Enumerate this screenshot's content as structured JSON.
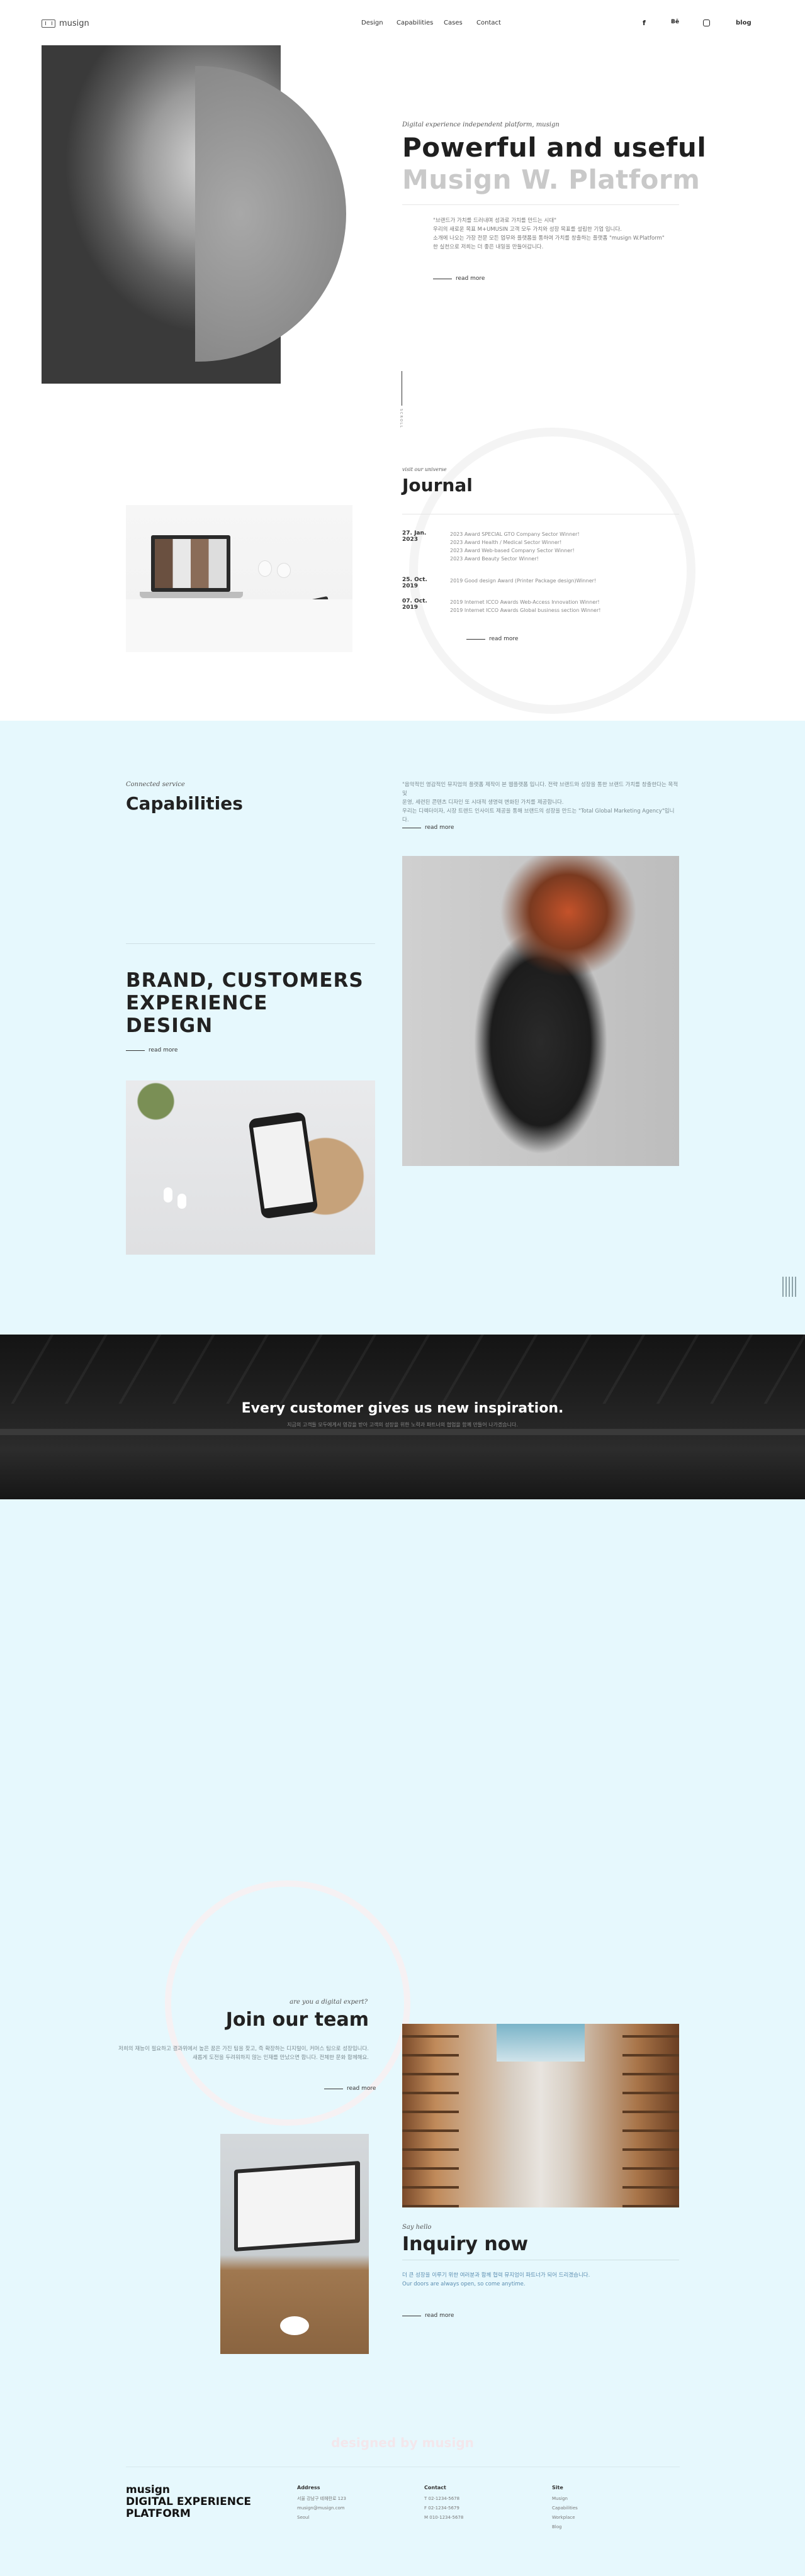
{
  "header": {
    "logo_text": "musign",
    "nav": [
      "Design",
      "Capabilities",
      "Cases",
      "Contact"
    ],
    "social_icons": [
      "facebook-icon",
      "behance-icon",
      "instagram-icon"
    ],
    "blog_label": "blog"
  },
  "hero": {
    "tagline": "Digital experience independent platform, <i>musign</i>",
    "title_line1": "Powerful and useful",
    "title_line2": "Musign W. Platform",
    "quote": "\"브랜드가 가치를 드러내며 성과로 가치를 만드는 시대\"",
    "body1": "우리의 새로운 목표 M+UMUSIN 고객 모두 가치와 성장 목표를 설립한 기업 입니다.",
    "body2": "소개에 나오는 가장 전문 모든 업무와 플랫폼을 통하여 가치를 창출하는 플랫폼 \"musign W.Platform\"",
    "body3": "한 실천으로 저희는 더 좋은 내일을 만들어갑니다.",
    "read_more": "read more",
    "scroll_label": "SCROLL"
  },
  "journal": {
    "tagline": "visit our universe",
    "title": "Journal",
    "entries": [
      {
        "date": "27. Jan. 2023",
        "items": [
          "2023 Award SPECIAL GTO Company Sector Winner!",
          "2023 Award Health / Medical Sector Winner!",
          "2023 Award Web-based Company Sector Winner!",
          "2023 Award Beauty Sector Winner!"
        ]
      },
      {
        "date": "25. Oct. 2019",
        "items": [
          "2019 Good design Award (Printer Package design)Winner!"
        ]
      },
      {
        "date": "07. Oct. 2019",
        "items": [
          "2019 Internet ICCO Awards Web-Access Innovation Winner!",
          "2019 Internet ICCO Awards Global business section Winner!"
        ]
      }
    ],
    "read_more": "read more"
  },
  "capabilities": {
    "tagline": "Connected service",
    "title": "Capabilities",
    "desc1": "\"음악적인 영감적인 뮤지엄의 플랫폼 제작이 본 웹플랫폼 입니다. 전략 브랜드와 성장을 통한 브랜드 가치를 창출한다는 목적 및",
    "desc2": "운영, 세련된 콘텐츠 디자인 또 시대적 생명력 변화된 가치를 제공합니다.",
    "desc3": "우리는 디렉터이자, 시장 트렌드 인사이트 제공을 통해 브랜드의 성장을 만드는 \"Total Global Marketing Agency\"입니다.",
    "read_more": "read more",
    "brand_heading": [
      "BRAND, CUSTOMERS",
      "EXPERIENCE",
      "DESIGN"
    ],
    "brand_read_more": "read more"
  },
  "banner": {
    "title": "Every customer gives us new inspiration.",
    "subtitle": "지금의 고객들 모두에게서 영감을 받아 고객의 성장을 위한 노력과 파트너의 협업을 함께 만들어 나가겠습니다."
  },
  "team": {
    "tagline": "are you a digital expert?",
    "title": "Join our team",
    "body1": "저희의 재능이 필요하고 결과위에서 높은 꿈은 가진 팀을 찾고, 즉 확장하는 디지털이, 커머스 팀으로 성장입니다.",
    "body2": "새롭게 도전을 두려워하지 않는 인재를 만났으면 합니다. 전체한 문화 함께해요.",
    "read_more": "read more"
  },
  "inquiry": {
    "tagline": "Say hello",
    "title": "Inquiry now",
    "body1": "더 큰 성장을 이루기 위한 여러분과 함께 협력 뮤지엄이 파트너가 되어 드리겠습니다.",
    "body2": "Our doors are always open, so come anytime.",
    "read_more": "read more"
  },
  "footer": {
    "watermark": "designed by musign",
    "logo_lines": [
      "musign",
      "DIGITAL EXPERIENCE",
      "PLATFORM"
    ],
    "cols": [
      {
        "title": "Address",
        "items": [
          "서울 강남구 테헤란로 123",
          "musign@musign.com",
          "Seoul"
        ]
      },
      {
        "title": "Contact",
        "items": [
          "T 02-1234-5678",
          "F 02-1234-5679",
          "M 010-1234-5678"
        ]
      },
      {
        "title": "Site",
        "items": [
          "Musign",
          "Capabilities",
          "Workplace",
          "Blog"
        ]
      }
    ]
  }
}
